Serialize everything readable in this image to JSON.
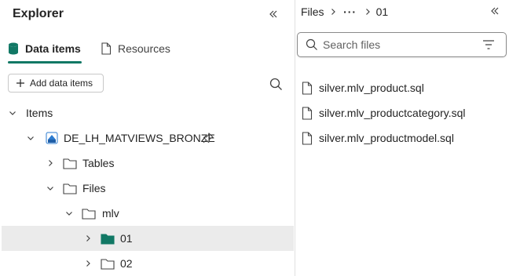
{
  "explorer": {
    "title": "Explorer",
    "tabs": [
      {
        "label": "Data items",
        "active": true
      },
      {
        "label": "Resources",
        "active": false
      }
    ],
    "add_button_label": "Add data items",
    "tree": {
      "root_label": "Items",
      "lakehouse_label": "DE_LH_MATVIEWS_BRONZE",
      "tables_label": "Tables",
      "files_label": "Files",
      "mlv_label": "mlv",
      "folder_01_label": "01",
      "folder_02_label": "02"
    }
  },
  "files_panel": {
    "breadcrumb": {
      "root": "Files",
      "more": "···",
      "current": "01"
    },
    "search_placeholder": "Search files",
    "files": [
      "silver.mlv_product.sql",
      "silver.mlv_productcategory.sql",
      "silver.mlv_productmodel.sql"
    ]
  },
  "colors": {
    "accent": "#117865",
    "selected_row": "#ebebeb",
    "border": "#c8c8c8"
  }
}
